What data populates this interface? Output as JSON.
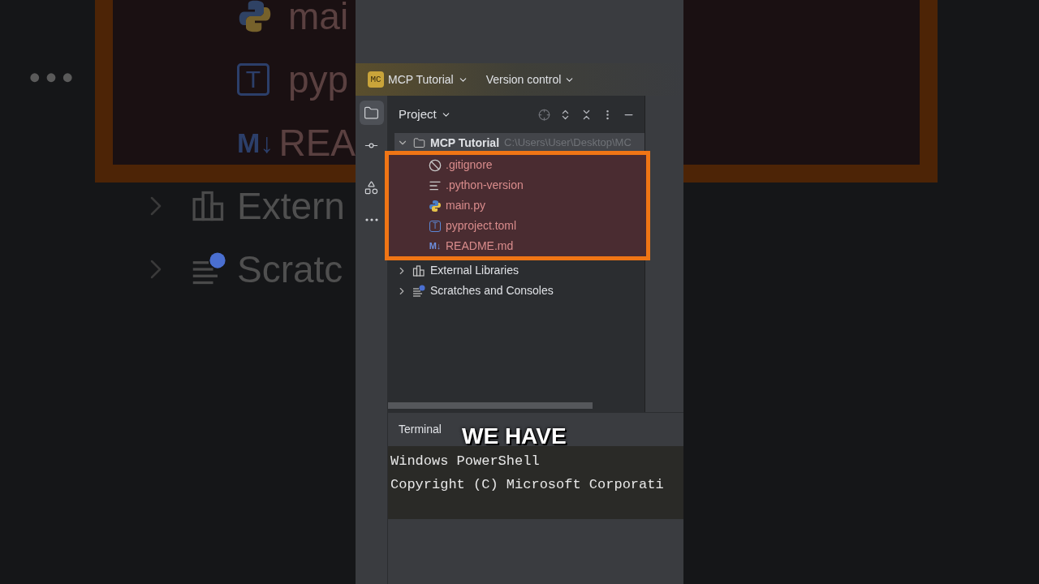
{
  "backdrop": {
    "rows": [
      {
        "kind": "python",
        "text": "mai"
      },
      {
        "kind": "toml",
        "badge": "T",
        "text": "pyp"
      },
      {
        "kind": "markdown",
        "badge": "M↓",
        "text": "REA"
      },
      {
        "kind": "libraries",
        "text": "Extern",
        "expanded": false
      },
      {
        "kind": "scratches",
        "text": "Scratc",
        "expanded": false
      }
    ]
  },
  "toolbar": {
    "project": {
      "badge": "MC",
      "name": "MCP Tutorial"
    },
    "vcs": "Version control"
  },
  "sidebar": {
    "items": [
      {
        "kind": "project",
        "selected": true
      },
      {
        "kind": "commit",
        "selected": false
      },
      {
        "kind": "structure",
        "selected": false
      },
      {
        "kind": "more",
        "selected": false
      }
    ]
  },
  "project": {
    "title": "Project",
    "root": {
      "name": "MCP Tutorial",
      "path": "C:\\Users\\User\\Desktop\\MC",
      "expanded": true,
      "selected": true,
      "children": [
        {
          "kind": "ignore",
          "name": ".gitignore",
          "selected": false
        },
        {
          "kind": "text",
          "name": ".python-version",
          "selected": false
        },
        {
          "kind": "python",
          "name": "main.py",
          "selected": false
        },
        {
          "kind": "toml",
          "badge": "T",
          "name": "pyproject.toml",
          "selected": false
        },
        {
          "kind": "markdown",
          "badge": "M↓",
          "name": "README.md",
          "selected": false
        }
      ]
    },
    "others": [
      {
        "kind": "libraries",
        "name": "External Libraries",
        "expanded": false,
        "selected": false
      },
      {
        "kind": "scratches",
        "name": "Scratches and Consoles",
        "expanded": false,
        "selected": false
      }
    ]
  },
  "terminal": {
    "tab": "Terminal",
    "lines": [
      "Windows PowerShell",
      "Copyright (C) Microsoft Corporati"
    ]
  },
  "caption": "WE HAVE"
}
